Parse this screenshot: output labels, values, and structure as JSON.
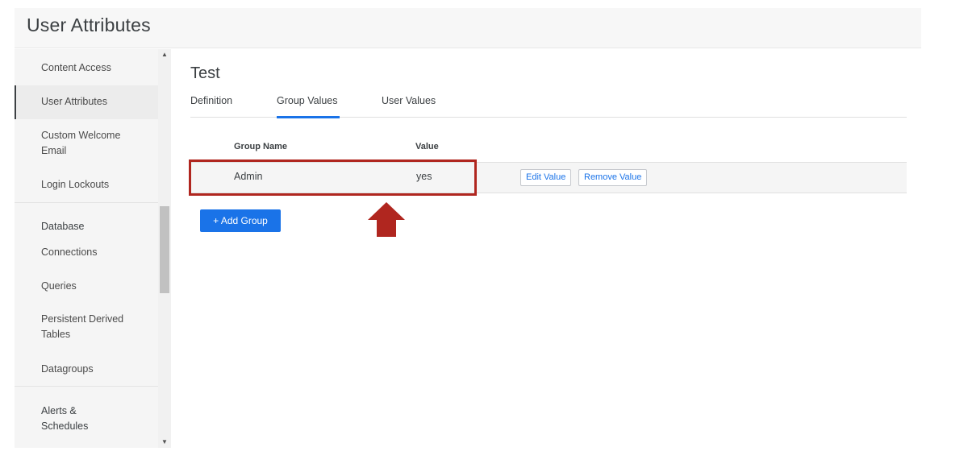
{
  "header": {
    "title": "User Attributes"
  },
  "sidebar": {
    "items": [
      {
        "label": "Content Access",
        "active": false
      },
      {
        "label": "User Attributes",
        "active": true
      },
      {
        "label": "Custom Welcome Email",
        "active": false
      },
      {
        "label": "Login Lockouts",
        "active": false
      }
    ],
    "database_section": {
      "heading": "Database",
      "items": [
        {
          "label": "Connections"
        },
        {
          "label": "Queries"
        },
        {
          "label": "Persistent Derived Tables"
        },
        {
          "label": "Datagroups"
        }
      ]
    },
    "alerts_section": {
      "heading": "Alerts & Schedules"
    }
  },
  "content": {
    "title": "Test",
    "tabs": [
      {
        "label": "Definition",
        "active": false
      },
      {
        "label": "Group Values",
        "active": true
      },
      {
        "label": "User Values",
        "active": false
      }
    ],
    "table": {
      "headers": [
        "Group Name",
        "Value"
      ],
      "rows": [
        {
          "group_name": "Admin",
          "value": "yes",
          "actions": [
            "Edit Value",
            "Remove Value"
          ]
        }
      ]
    },
    "add_group_label": "+ Add Group"
  },
  "colors": {
    "accent": "#1a73e8",
    "highlight": "#b0261f",
    "sidebar_bg": "#f5f5f5"
  },
  "icons": {
    "scroll_up": "triangle-up-icon",
    "scroll_down": "triangle-down-icon",
    "annotation": "arrow-up-icon"
  }
}
